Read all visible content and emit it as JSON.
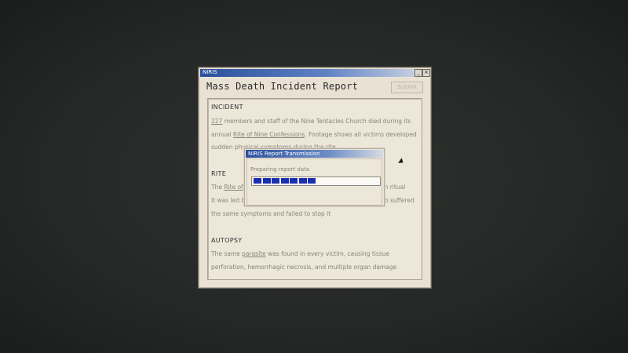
{
  "window": {
    "title": "NIRIS",
    "minimize_label": "_",
    "close_label": "×",
    "header_title": "Mass Death Incident Report",
    "submit_label": "Submit"
  },
  "report": {
    "incident": {
      "heading": "INCIDENT",
      "line1_link": "227",
      "line1_rest": " members and staff of the Nine Tentacles Church died during its",
      "line2_pre": "annual ",
      "line2_link": "Rite of Nine Confessions",
      "line2_rest": ". Footage shows all victims developed",
      "line3": "sudden physical symptoms during the rite"
    },
    "rite": {
      "heading": "RITE",
      "line1_pre": "The ",
      "line1_link": "Rite of",
      "line1_tail": "sion ritual",
      "line2_pre": "It was led b",
      "line2_tail": "o suffered",
      "line3": "the same symptoms and failed to stop it"
    },
    "autopsy": {
      "heading": "AUTOPSY",
      "line1_pre": "The same ",
      "line1_link": "parasite",
      "line1_rest": " was found in every victim, causing tissue",
      "line2": "perforation, hemorrhagic necrosis, and multiple organ damage"
    }
  },
  "dialog": {
    "title": "NIRIS Report Transmission",
    "status": "Preparing report data",
    "progress_segments": 7
  },
  "colors": {
    "titlebar": "#2a4f9c",
    "progress_fill": "#1a2fb0"
  }
}
